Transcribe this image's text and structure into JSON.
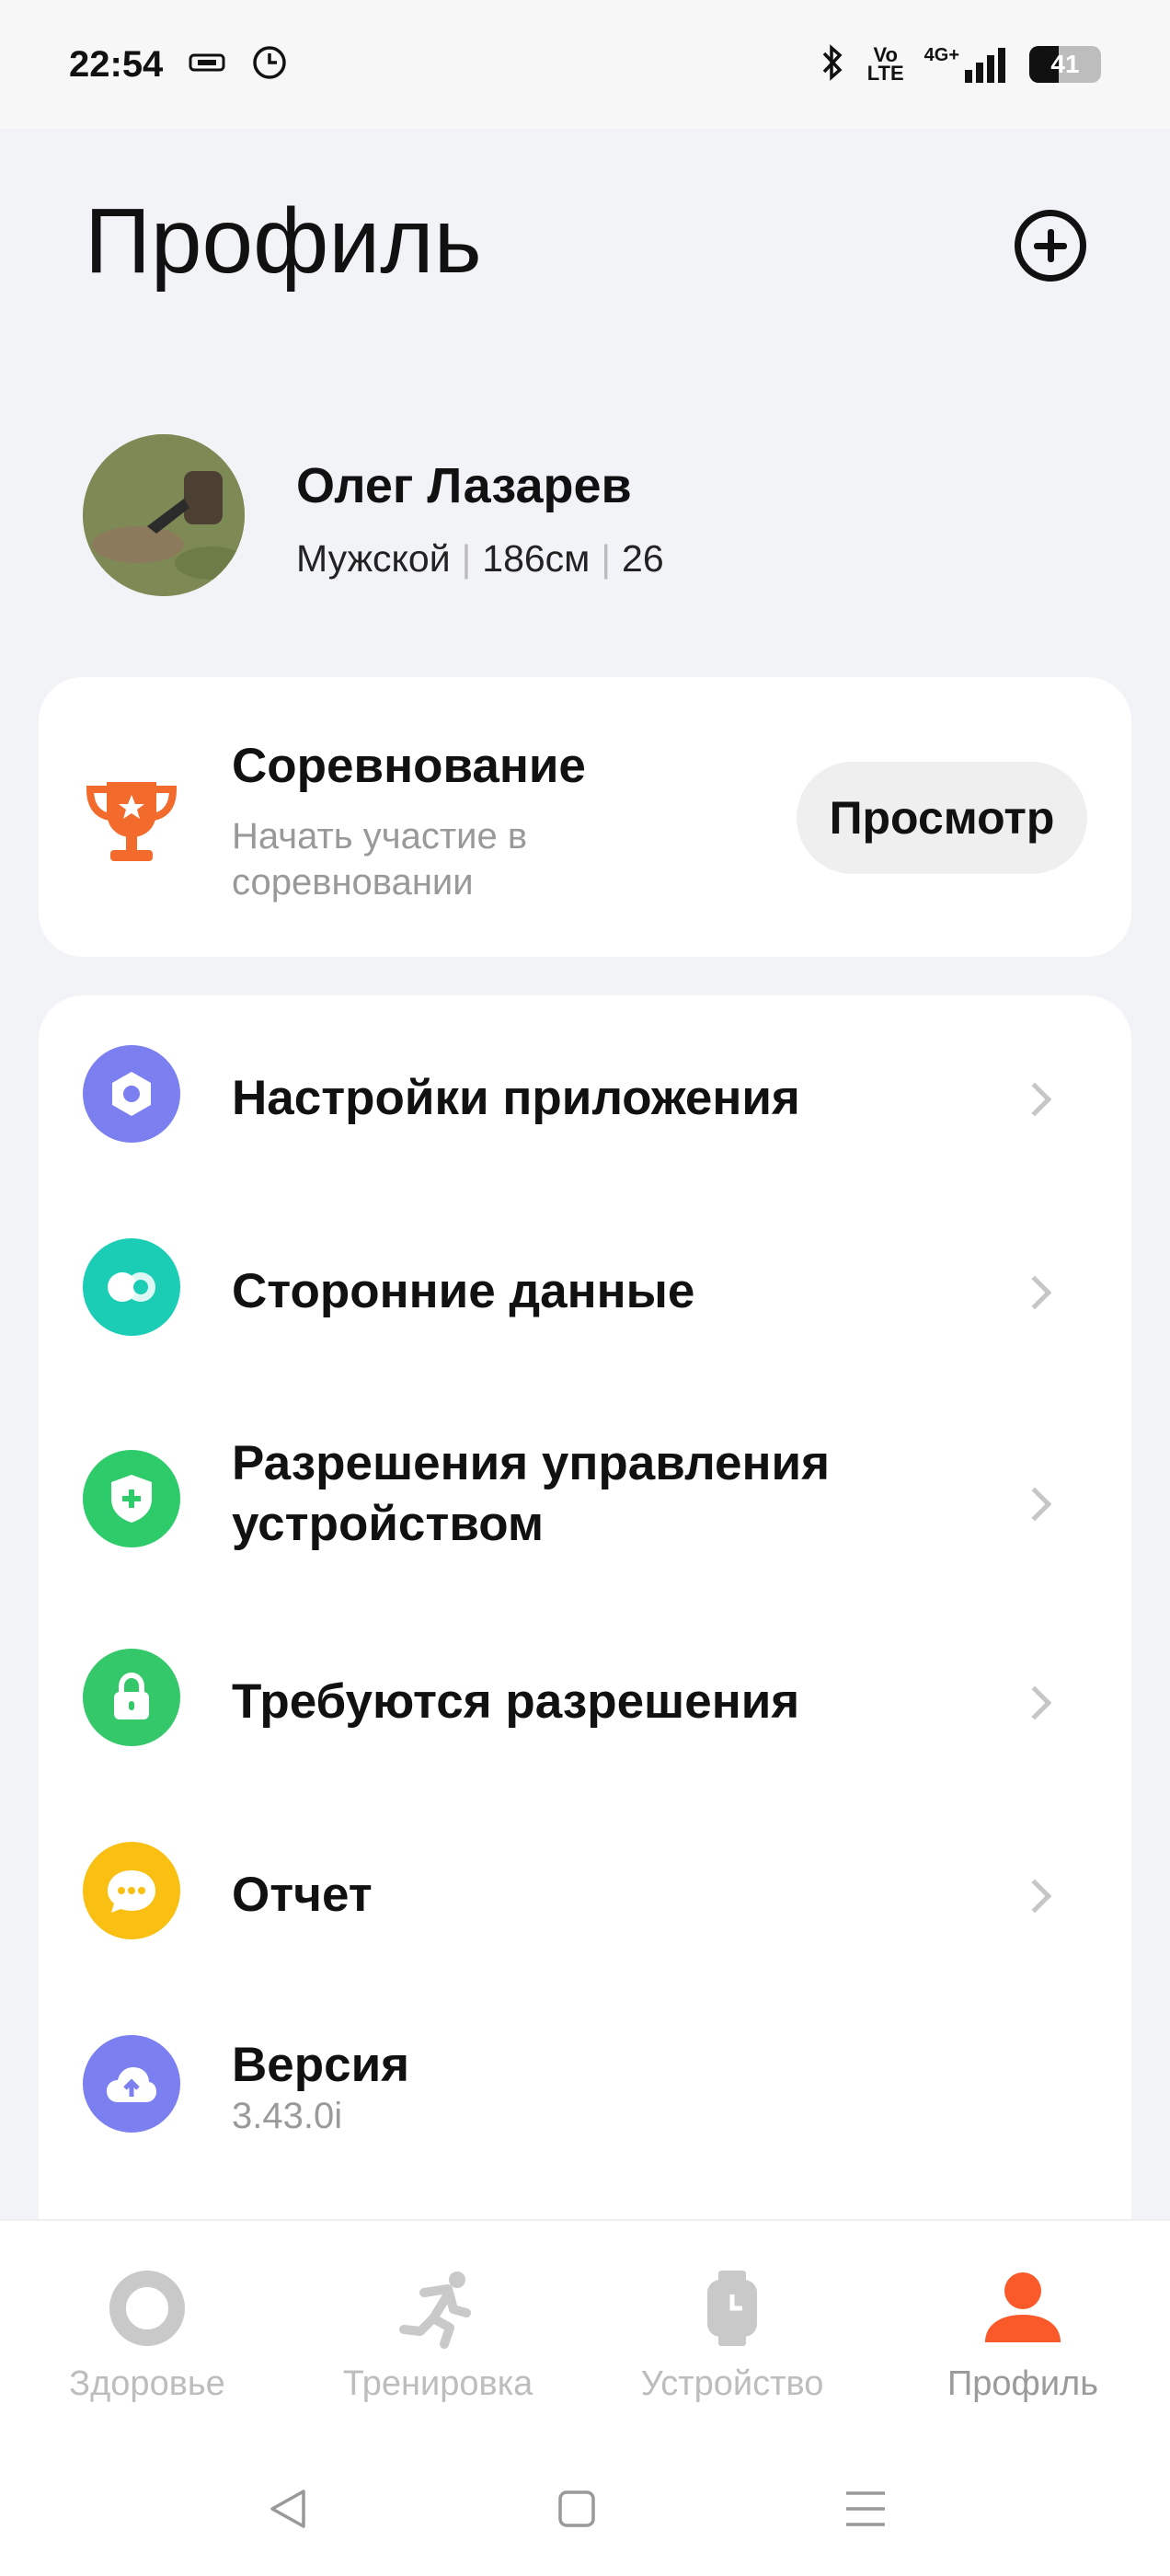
{
  "status_bar": {
    "time": "22:54",
    "volte_top": "Vo",
    "volte_bottom": "LTE",
    "network": "4G+",
    "battery_level": "41",
    "battery_fraction": 0.41,
    "icons": [
      "nfc-icon",
      "clock-icon",
      "bluetooth-icon",
      "signal-icon",
      "battery-icon"
    ]
  },
  "header": {
    "title": "Профиль",
    "add_icon": "plus-circle-icon"
  },
  "profile": {
    "name": "Олег Лазарев",
    "gender": "Мужской",
    "height": "186см",
    "age": "26"
  },
  "competition": {
    "title": "Соревнование",
    "subtitle": "Начать участие в соревновании",
    "button_label": "Просмотр",
    "icon": "trophy-icon",
    "color": "#f26a2c"
  },
  "menu": [
    {
      "label": "Настройки приложения",
      "icon": "settings-icon",
      "color": "#7b7ff0"
    },
    {
      "label": "Сторонние данные",
      "icon": "third-party-icon",
      "color": "#1ccdb5"
    },
    {
      "label": "Разрешения управления устройством",
      "icon": "shield-icon",
      "color": "#2ecb6a"
    },
    {
      "label": "Требуются разрешения",
      "icon": "lock-icon",
      "color": "#34c86a"
    },
    {
      "label": "Отчет",
      "icon": "chat-icon",
      "color": "#f9c013"
    },
    {
      "label": "Версия",
      "sub": "3.43.0i",
      "icon": "cloud-upload-icon",
      "color": "#7b7ff0"
    }
  ],
  "bottom_nav": [
    {
      "label": "Здоровье",
      "icon": "health-ring-icon"
    },
    {
      "label": "Тренировка",
      "icon": "running-icon"
    },
    {
      "label": "Устройство",
      "icon": "watch-icon"
    },
    {
      "label": "Профиль",
      "icon": "person-icon",
      "active": true
    }
  ],
  "colors": {
    "accent": "#fa5a2a",
    "background": "#f2f3f7"
  }
}
